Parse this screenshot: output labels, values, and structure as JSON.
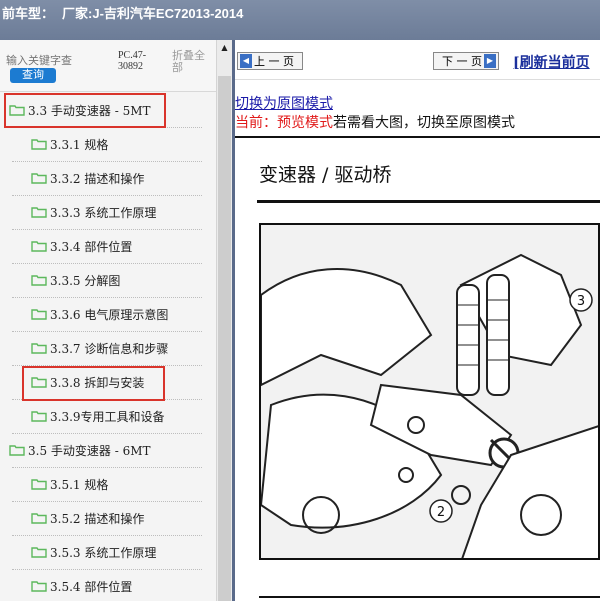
{
  "titlebar": {
    "prefix": "前车型：",
    "manufacturer": "厂家:J-吉利汽车EC72013-2014"
  },
  "sidebar": {
    "search_placeholder": "输入关键字查",
    "search_button": "查询",
    "pc_code": "PC.47-30892",
    "collapse_all": "折叠全部",
    "items": [
      {
        "label": "3.3 手动变速器 - 5MT",
        "level": 0
      },
      {
        "label": "3.3.1 规格",
        "level": 1
      },
      {
        "label": "3.3.2 描述和操作",
        "level": 1
      },
      {
        "label": "3.3.3 系统工作原理",
        "level": 1
      },
      {
        "label": "3.3.4 部件位置",
        "level": 1
      },
      {
        "label": "3.3.5 分解图",
        "level": 1
      },
      {
        "label": "3.3.6 电气原理示意图",
        "level": 1
      },
      {
        "label": "3.3.7 诊断信息和步骤",
        "level": 1
      },
      {
        "label": "3.3.8 拆卸与安装",
        "level": 1
      },
      {
        "label": "3.3.9专用工具和设备",
        "level": 1
      },
      {
        "label": "3.5 手动变速器 - 6MT",
        "level": 0
      },
      {
        "label": "3.5.1 规格",
        "level": 1
      },
      {
        "label": "3.5.2 描述和操作",
        "level": 1
      },
      {
        "label": "3.5.3 系统工作原理",
        "level": 1
      },
      {
        "label": "3.5.4 部件位置",
        "level": 1
      }
    ],
    "highlighted": [
      "3.3 手动变速器 - 5MT",
      "3.3.8 拆卸与安装"
    ]
  },
  "content": {
    "prev_button": "上 一 页",
    "next_button": "下 一 页",
    "refresh_link": "[刷新当前页",
    "mode_link": "切换为原图模式",
    "mode_current_prefix": "当前：",
    "mode_current_value": "预览模式",
    "mode_hint": "若需看大图，切换至原图模式",
    "doc_title": "变速器 / 驱动桥",
    "figure_callouts": [
      "3",
      "2"
    ]
  },
  "colors": {
    "highlight": "#d9342b",
    "link": "#1a1aa8",
    "mode_red": "#e11a1a",
    "folder": "#5cb85c",
    "search_button": "#1c7bd1"
  }
}
